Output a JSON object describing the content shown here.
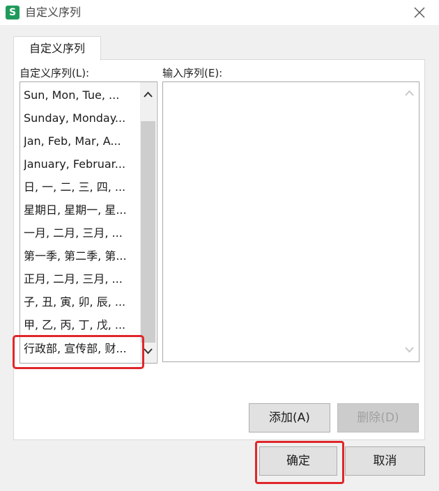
{
  "dialog": {
    "title": "自定义序列",
    "app_icon_letter": "S",
    "tab_label": "自定义序列"
  },
  "custom_list": {
    "label": "自定义序列(L):",
    "items": [
      "Sun, Mon, Tue, ...",
      "Sunday, Monday...",
      "Jan, Feb, Mar, A...",
      "January, Februar...",
      "日, 一, 二, 三, 四, ...",
      "星期日, 星期一, 星...",
      "一月, 二月, 三月, ...",
      "第一季, 第二季, 第...",
      "正月, 二月, 三月, ...",
      "子, 丑, 寅, 卯, 辰, ...",
      "甲, 乙, 丙, 丁, 戊, ...",
      "行政部, 宣传部, 财..."
    ],
    "selected_index": 11
  },
  "input_sequence": {
    "label": "输入序列(E):",
    "value": ""
  },
  "buttons": {
    "add": "添加(A)",
    "delete": "删除(D)",
    "ok": "确定",
    "cancel": "取消"
  },
  "colors": {
    "highlight": "#e0262b",
    "app_icon": "#1f9a5b"
  }
}
